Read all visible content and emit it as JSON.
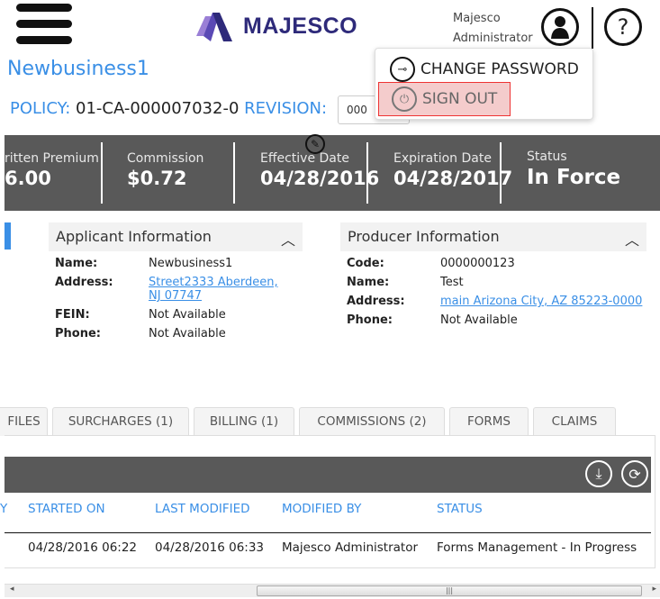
{
  "header": {
    "logo_text": "MAJESCO",
    "user_first": "Majesco",
    "user_last": "Administrator",
    "help_glyph": "?"
  },
  "user_menu": {
    "change_password": "CHANGE PASSWORD",
    "sign_out": "SIGN OUT"
  },
  "page": {
    "title": "Newbusiness1",
    "policy_label": "POLICY:",
    "policy_number": "01-CA-000007032-0",
    "revision_label": "REVISION:",
    "revision_value": "000"
  },
  "summary": [
    {
      "label": "ritten Premium",
      "value": "6.00"
    },
    {
      "label": "Commission",
      "value": "$0.72"
    },
    {
      "label": "Effective Date",
      "value": "04/28/2016"
    },
    {
      "label": "Expiration Date",
      "value": "04/28/2017"
    },
    {
      "label": "Status",
      "value": "In Force"
    }
  ],
  "applicant": {
    "title": "Applicant Information",
    "rows": [
      {
        "k": "Name:",
        "v": "Newbusiness1"
      },
      {
        "k": "Address:",
        "v": "Street2333 Aberdeen, NJ 07747",
        "link": true
      },
      {
        "k": "FEIN:",
        "v": "Not Available"
      },
      {
        "k": "Phone:",
        "v": "Not Available"
      }
    ]
  },
  "producer": {
    "title": "Producer Information",
    "rows": [
      {
        "k": "Code:",
        "v": "0000000123"
      },
      {
        "k": "Name:",
        "v": "Test"
      },
      {
        "k": "Address:",
        "v": "main Arizona City, AZ 85223-0000",
        "link": true
      },
      {
        "k": "Phone:",
        "v": "Not Available"
      }
    ]
  },
  "tabs": [
    "FILES",
    "SURCHARGES (1)",
    "BILLING (1)",
    "COMMISSIONS (2)",
    "FORMS",
    "CLAIMS"
  ],
  "table": {
    "columns": [
      "Y",
      "STARTED ON",
      "LAST MODIFIED",
      "MODIFIED BY",
      "STATUS"
    ],
    "rows": [
      [
        "04/28/2016 06:22",
        "04/28/2016 06:33",
        "Majesco Administrator",
        "Forms Management - In Progress"
      ]
    ]
  },
  "colors": {
    "accent": "#3a8fe6",
    "banner": "#595959",
    "logo": "#2e2a7a",
    "signout_highlight": "#f4cccc"
  }
}
